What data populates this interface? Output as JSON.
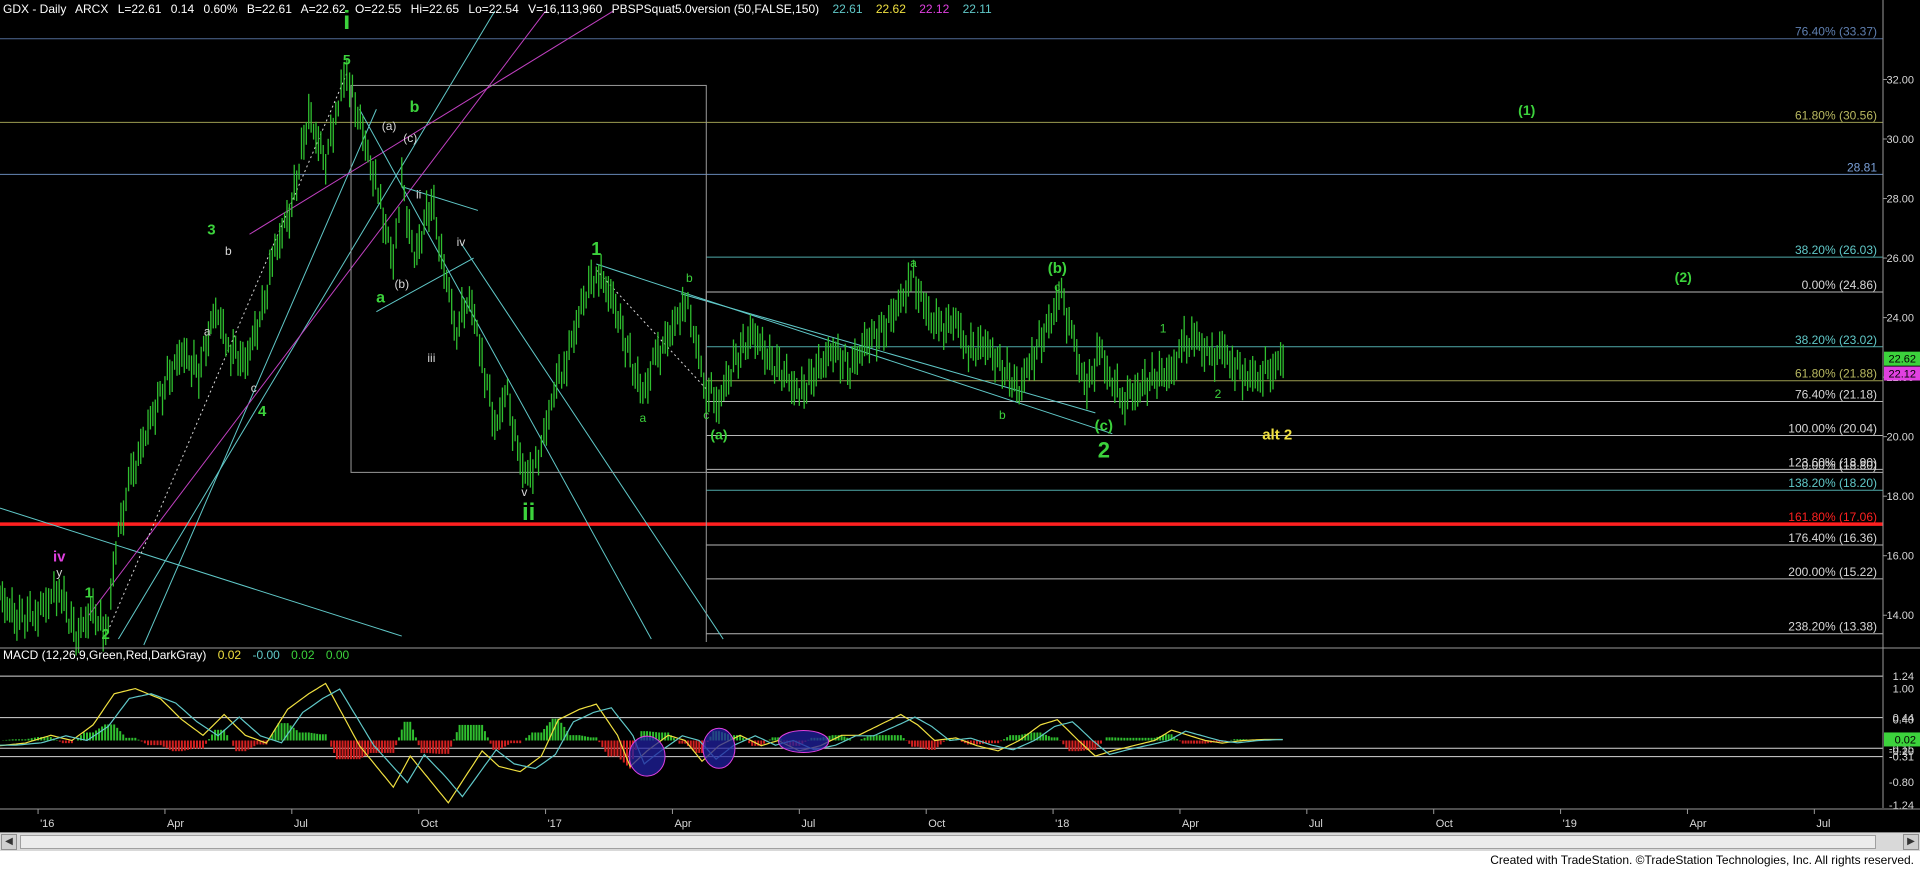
{
  "chart_data": {
    "type": "candlestick",
    "header": {
      "symbol": "GDX - Daily",
      "exchange": "ARCX",
      "last": "L=22.61",
      "change": "0.14",
      "change_pct": "0.60%",
      "bid": "B=22.61",
      "ask": "A=22.62",
      "open": "O=22.55",
      "high": "Hi=22.65",
      "low": "Lo=22.54",
      "volume": "V=16,113,960",
      "study": "PBSPSquat5.0version (50,FALSE,150)",
      "study_values": [
        "22.61",
        "22.62",
        "22.12",
        "22.11"
      ]
    },
    "ylim": [
      13.0,
      34.2
    ],
    "y_ticks": [
      "32.00",
      "30.00",
      "28.00",
      "26.00",
      "24.00",
      "22.00",
      "20.00",
      "18.00",
      "16.00",
      "14.00"
    ],
    "x_ticks": [
      {
        "label": "'16",
        "t": 0
      },
      {
        "label": "Apr",
        "t": 3
      },
      {
        "label": "Jul",
        "t": 6
      },
      {
        "label": "Oct",
        "t": 9
      },
      {
        "label": "'17",
        "t": 12
      },
      {
        "label": "Apr",
        "t": 15
      },
      {
        "label": "Jul",
        "t": 18
      },
      {
        "label": "Oct",
        "t": 21
      },
      {
        "label": "'18",
        "t": 24
      },
      {
        "label": "Apr",
        "t": 27
      },
      {
        "label": "Jul",
        "t": 30
      },
      {
        "label": "Oct",
        "t": 33
      },
      {
        "label": "'19",
        "t": 36
      },
      {
        "label": "Apr",
        "t": 39
      },
      {
        "label": "Jul",
        "t": 42
      }
    ],
    "xlim": [
      -0.9,
      43.6
    ],
    "price_path": [
      [
        -0.9,
        14.6
      ],
      [
        -0.5,
        13.9
      ],
      [
        0,
        14.1
      ],
      [
        0.5,
        14.9
      ],
      [
        0.9,
        13.3
      ],
      [
        1.3,
        14.2
      ],
      [
        1.6,
        13.3
      ],
      [
        1.9,
        16.8
      ],
      [
        2.2,
        18.6
      ],
      [
        2.6,
        20.3
      ],
      [
        3.0,
        21.8
      ],
      [
        3.4,
        22.8
      ],
      [
        3.8,
        22.2
      ],
      [
        4.2,
        24.3
      ],
      [
        4.5,
        23.0
      ],
      [
        4.9,
        22.5
      ],
      [
        5.3,
        24.2
      ],
      [
        5.6,
        26.2
      ],
      [
        6.0,
        27.8
      ],
      [
        6.4,
        30.8
      ],
      [
        6.8,
        29.2
      ],
      [
        7.1,
        31.3
      ],
      [
        7.3,
        32.2
      ],
      [
        7.5,
        31.2
      ],
      [
        7.8,
        29.5
      ],
      [
        8.1,
        27.8
      ],
      [
        8.4,
        25.8
      ],
      [
        8.6,
        28.6
      ],
      [
        8.9,
        25.9
      ],
      [
        9.3,
        28.0
      ],
      [
        9.6,
        25.6
      ],
      [
        9.9,
        23.6
      ],
      [
        10.2,
        24.8
      ],
      [
        10.5,
        22.6
      ],
      [
        10.8,
        20.4
      ],
      [
        11.1,
        21.4
      ],
      [
        11.4,
        19.0
      ],
      [
        11.7,
        18.7
      ],
      [
        11.9,
        19.6
      ],
      [
        12.2,
        21.6
      ],
      [
        12.5,
        22.6
      ],
      [
        12.9,
        24.6
      ],
      [
        13.2,
        25.6
      ],
      [
        13.6,
        24.6
      ],
      [
        14.0,
        22.6
      ],
      [
        14.3,
        21.4
      ],
      [
        14.6,
        22.6
      ],
      [
        15.0,
        23.6
      ],
      [
        15.3,
        24.6
      ],
      [
        15.5,
        23.5
      ],
      [
        15.8,
        21.6
      ],
      [
        16.1,
        21.2
      ],
      [
        16.5,
        22.6
      ],
      [
        16.9,
        23.5
      ],
      [
        17.3,
        22.6
      ],
      [
        17.7,
        22.0
      ],
      [
        18.0,
        21.4
      ],
      [
        18.4,
        22.2
      ],
      [
        18.8,
        22.9
      ],
      [
        19.2,
        22.3
      ],
      [
        19.6,
        23.2
      ],
      [
        20.0,
        23.6
      ],
      [
        20.4,
        24.6
      ],
      [
        20.7,
        25.3
      ],
      [
        21.0,
        24.2
      ],
      [
        21.3,
        23.6
      ],
      [
        21.7,
        23.9
      ],
      [
        22.0,
        22.9
      ],
      [
        22.4,
        23.1
      ],
      [
        22.8,
        22.3
      ],
      [
        23.2,
        21.6
      ],
      [
        23.5,
        22.6
      ],
      [
        23.9,
        23.8
      ],
      [
        24.2,
        24.8
      ],
      [
        24.5,
        23.0
      ],
      [
        24.8,
        21.6
      ],
      [
        25.1,
        22.9
      ],
      [
        25.4,
        21.8
      ],
      [
        25.7,
        21.3
      ],
      [
        26.0,
        21.6
      ],
      [
        26.4,
        22.0
      ],
      [
        26.8,
        22.2
      ],
      [
        27.1,
        23.1
      ],
      [
        27.4,
        23.3
      ],
      [
        27.7,
        22.6
      ],
      [
        28.0,
        22.9
      ],
      [
        28.3,
        22.4
      ],
      [
        28.6,
        22.0
      ],
      [
        28.9,
        22.1
      ],
      [
        29.2,
        22.4
      ],
      [
        29.5,
        22.6
      ]
    ],
    "support_resistance": [
      {
        "label": "76.40% (33.37)",
        "value": 33.37,
        "color": "#5f7fb0"
      },
      {
        "label": "61.80% (30.56)",
        "value": 30.56,
        "color": "#b8b860"
      },
      {
        "label": "28.81",
        "value": 28.81,
        "color": "#7aa0d8"
      },
      {
        "label": "38.20% (26.03)",
        "value": 26.03,
        "color": "#60c8c8"
      },
      {
        "label": "0.00% (24.86)",
        "value": 24.86,
        "color": "#d8d8d8"
      },
      {
        "label": "38.20% (23.02)",
        "value": 23.02,
        "color": "#60c8c8"
      },
      {
        "label": "61.80% (21.88)",
        "value": 21.88,
        "color": "#b8b860"
      },
      {
        "label": "76.40% (21.18)",
        "value": 21.18,
        "color": "#d8d8d8"
      },
      {
        "label": "100.00% (20.04)",
        "value": 20.04,
        "color": "#d8d8d8"
      },
      {
        "label": "123.60% (18.90)",
        "value": 18.9,
        "color": "#d8d8d8"
      },
      {
        "label": "0.00% (18.80)",
        "value": 18.8,
        "color": "#d8d8d8"
      },
      {
        "label": "138.20% (18.20)",
        "value": 18.2,
        "color": "#60c8c8"
      },
      {
        "label": "161.80% (17.06)",
        "value": 17.06,
        "color": "#ff2020"
      },
      {
        "label": "176.40% (16.36)",
        "value": 16.36,
        "color": "#d8d8d8"
      },
      {
        "label": "200.00% (15.22)",
        "value": 15.22,
        "color": "#d8d8d8"
      },
      {
        "label": "238.20% (13.38)",
        "value": 13.38,
        "color": "#d8d8d8"
      }
    ],
    "wave_labels": [
      {
        "text": "i",
        "t": 7.3,
        "y": 33.7,
        "color": "#3cd23c",
        "size": 26
      },
      {
        "text": "5",
        "t": 7.3,
        "y": 32.5,
        "color": "#3cd23c",
        "size": 14
      },
      {
        "text": "b",
        "t": 8.9,
        "y": 30.9,
        "color": "#3cd23c",
        "size": 16
      },
      {
        "text": "(a)",
        "t": 8.3,
        "y": 30.3,
        "color": "#d8d8d8",
        "size": 12
      },
      {
        "text": "(c)",
        "t": 8.8,
        "y": 29.9,
        "color": "#d8d8d8",
        "size": 12
      },
      {
        "text": "ii",
        "t": 9.0,
        "y": 28.0,
        "color": "#d8d8d8",
        "size": 12
      },
      {
        "text": "iv",
        "t": 10.0,
        "y": 26.4,
        "color": "#d8d8d8",
        "size": 12
      },
      {
        "text": "(b)",
        "t": 8.6,
        "y": 25.0,
        "color": "#d8d8d8",
        "size": 12
      },
      {
        "text": "a",
        "t": 8.1,
        "y": 24.5,
        "color": "#3cd23c",
        "size": 16
      },
      {
        "text": "iii",
        "t": 9.3,
        "y": 22.5,
        "color": "#d8d8d8",
        "size": 12
      },
      {
        "text": "v",
        "t": 11.5,
        "y": 18.0,
        "color": "#d8d8d8",
        "size": 12
      },
      {
        "text": "ii",
        "t": 11.6,
        "y": 17.2,
        "color": "#3cd23c",
        "size": 24
      },
      {
        "text": "3",
        "t": 4.1,
        "y": 26.8,
        "color": "#3cd23c",
        "size": 15
      },
      {
        "text": "b",
        "t": 4.5,
        "y": 26.1,
        "color": "#d8d8d8",
        "size": 12
      },
      {
        "text": "a",
        "t": 4.0,
        "y": 23.4,
        "color": "#d8d8d8",
        "size": 12
      },
      {
        "text": "c",
        "t": 5.1,
        "y": 21.5,
        "color": "#d8d8d8",
        "size": 12
      },
      {
        "text": "4",
        "t": 5.3,
        "y": 20.7,
        "color": "#3cd23c",
        "size": 15
      },
      {
        "text": "iv",
        "t": 0.5,
        "y": 15.8,
        "color": "#e040e0",
        "size": 15
      },
      {
        "text": "y",
        "t": 0.5,
        "y": 15.3,
        "color": "#d8d8d8",
        "size": 12
      },
      {
        "text": "1",
        "t": 1.2,
        "y": 14.6,
        "color": "#3cd23c",
        "size": 15
      },
      {
        "text": "2",
        "t": 1.6,
        "y": 13.2,
        "color": "#3cd23c",
        "size": 15
      },
      {
        "text": "1",
        "t": 13.2,
        "y": 26.1,
        "color": "#3cd23c",
        "size": 18
      },
      {
        "text": "b",
        "t": 15.4,
        "y": 25.2,
        "color": "#3cd23c",
        "size": 12
      },
      {
        "text": "a",
        "t": 14.3,
        "y": 20.5,
        "color": "#3cd23c",
        "size": 12
      },
      {
        "text": "c",
        "t": 15.8,
        "y": 20.6,
        "color": "#3cd23c",
        "size": 12
      },
      {
        "text": "(a)",
        "t": 16.1,
        "y": 19.9,
        "color": "#3cd23c",
        "size": 14
      },
      {
        "text": "a",
        "t": 20.7,
        "y": 25.7,
        "color": "#3cd23c",
        "size": 12
      },
      {
        "text": "(b)",
        "t": 24.1,
        "y": 25.5,
        "color": "#3cd23c",
        "size": 15
      },
      {
        "text": "c",
        "t": 24.1,
        "y": 24.9,
        "color": "#3cd23c",
        "size": 12
      },
      {
        "text": "b",
        "t": 22.8,
        "y": 20.6,
        "color": "#3cd23c",
        "size": 12
      },
      {
        "text": "(c)",
        "t": 25.2,
        "y": 20.2,
        "color": "#3cd23c",
        "size": 15
      },
      {
        "text": "2",
        "t": 25.2,
        "y": 19.3,
        "color": "#3cd23c",
        "size": 22
      },
      {
        "text": "1",
        "t": 26.6,
        "y": 23.5,
        "color": "#3cd23c",
        "size": 12
      },
      {
        "text": "2",
        "t": 27.9,
        "y": 21.3,
        "color": "#3cd23c",
        "size": 12
      },
      {
        "text": "alt 2",
        "t": 29.3,
        "y": 19.9,
        "color": "#f0e040",
        "size": 15
      },
      {
        "text": "(1)",
        "t": 35.2,
        "y": 30.8,
        "color": "#3cd23c",
        "size": 14
      },
      {
        "text": "(2)",
        "t": 38.9,
        "y": 25.2,
        "color": "#3cd23c",
        "size": 14
      }
    ],
    "macd": {
      "label": "MACD (12,26,9,Green,Red,DarkGray)",
      "values": [
        "0.02",
        "-0.00",
        "0.02",
        "0.00"
      ],
      "value_colors": [
        "#f0e040",
        "#60c8c8",
        "#3cd23c",
        "#3cd23c"
      ],
      "ylim": [
        -1.3,
        1.55
      ],
      "ticks": [
        "1.24",
        "1.00",
        "0.44",
        "0.40",
        "-0.15",
        "-0.20",
        "-0.31",
        "-0.80",
        "-1.24"
      ],
      "tick_values": [
        1.24,
        1.0,
        0.44,
        0.4,
        -0.15,
        -0.2,
        -0.31,
        -0.8,
        -1.24
      ],
      "levels": [
        1.24,
        0.44,
        -0.15,
        -0.31
      ],
      "current_value": "0.02",
      "series": [
        [
          -0.9,
          -0.1
        ],
        [
          -0.3,
          -0.05
        ],
        [
          0.3,
          0.1
        ],
        [
          0.8,
          0.0
        ],
        [
          1.3,
          0.3
        ],
        [
          1.8,
          0.9
        ],
        [
          2.3,
          1.0
        ],
        [
          2.9,
          0.8
        ],
        [
          3.4,
          0.4
        ],
        [
          3.9,
          0.1
        ],
        [
          4.4,
          0.5
        ],
        [
          4.9,
          0.1
        ],
        [
          5.4,
          -0.05
        ],
        [
          5.9,
          0.6
        ],
        [
          6.4,
          0.9
        ],
        [
          6.8,
          1.1
        ],
        [
          7.2,
          0.5
        ],
        [
          7.6,
          -0.1
        ],
        [
          8.0,
          -0.5
        ],
        [
          8.4,
          -0.9
        ],
        [
          8.8,
          -0.3
        ],
        [
          9.2,
          -0.7
        ],
        [
          9.7,
          -1.2
        ],
        [
          10.1,
          -0.7
        ],
        [
          10.5,
          -0.2
        ],
        [
          10.9,
          -0.5
        ],
        [
          11.4,
          -0.6
        ],
        [
          11.9,
          -0.3
        ],
        [
          12.3,
          0.4
        ],
        [
          12.8,
          0.6
        ],
        [
          13.2,
          0.7
        ],
        [
          13.7,
          0.1
        ],
        [
          14.0,
          -0.5
        ],
        [
          14.4,
          -0.2
        ],
        [
          14.9,
          0.1
        ],
        [
          15.3,
          0.0
        ],
        [
          15.7,
          -0.4
        ],
        [
          16.1,
          -0.1
        ],
        [
          16.6,
          0.1
        ],
        [
          17.1,
          -0.1
        ],
        [
          17.5,
          0.0
        ],
        [
          18.0,
          -0.2
        ],
        [
          18.5,
          -0.1
        ],
        [
          19.0,
          0.1
        ],
        [
          19.4,
          0.1
        ],
        [
          19.9,
          0.3
        ],
        [
          20.4,
          0.5
        ],
        [
          20.8,
          0.3
        ],
        [
          21.2,
          0.0
        ],
        [
          21.7,
          0.05
        ],
        [
          22.2,
          -0.1
        ],
        [
          22.7,
          -0.2
        ],
        [
          23.2,
          0.0
        ],
        [
          23.7,
          0.3
        ],
        [
          24.1,
          0.4
        ],
        [
          24.6,
          0.0
        ],
        [
          25.0,
          -0.3
        ],
        [
          25.4,
          -0.2
        ],
        [
          25.9,
          -0.1
        ],
        [
          26.4,
          0.0
        ],
        [
          26.8,
          0.2
        ],
        [
          27.2,
          0.1
        ],
        [
          27.6,
          0.0
        ],
        [
          28.0,
          -0.05
        ],
        [
          28.5,
          0.0
        ],
        [
          29.0,
          0.02
        ],
        [
          29.5,
          0.02
        ]
      ]
    },
    "last_price_tags": [
      "22.62",
      "22.12"
    ]
  },
  "footer": {
    "credit": "Created with TradeStation. ©TradeStation Technologies, Inc. All rights reserved."
  },
  "scrollbar": {
    "left_icon": "arrow-left-icon",
    "right_icon": "arrow-right-icon"
  }
}
